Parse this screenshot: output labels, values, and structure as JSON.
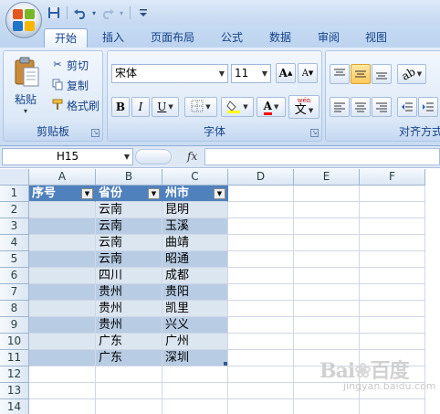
{
  "qat": {
    "items": [
      {
        "icon": "save-icon",
        "glyph": "💾"
      },
      {
        "icon": "undo-icon",
        "glyph": "↶"
      },
      {
        "icon": "redo-icon",
        "glyph": "↷"
      },
      {
        "icon": "customize-qat-icon",
        "glyph": "▾"
      }
    ]
  },
  "tabs": [
    {
      "label": "开始",
      "active": true
    },
    {
      "label": "插入"
    },
    {
      "label": "页面布局"
    },
    {
      "label": "公式"
    },
    {
      "label": "数据"
    },
    {
      "label": "审阅"
    },
    {
      "label": "视图"
    }
  ],
  "clipboard": {
    "paste": "粘贴",
    "cut": "剪切",
    "copy": "复制",
    "format_painter": "格式刷",
    "group_label": "剪贴板"
  },
  "font": {
    "name": "宋体",
    "size": "11",
    "grow": "A",
    "shrink": "A",
    "bold": "B",
    "italic": "I",
    "underline": "U",
    "font_color": "A",
    "phonetic": "文",
    "phonetic_top": "wén",
    "group_label": "字体"
  },
  "alignment": {
    "group_label": "对齐方式"
  },
  "formula_bar": {
    "name_box": "H15",
    "fx": "fx",
    "formula": ""
  },
  "sheet": {
    "columns": [
      "A",
      "B",
      "C",
      "D",
      "E",
      "F"
    ],
    "rows": [
      "1",
      "2",
      "3",
      "4",
      "5",
      "6",
      "7",
      "8",
      "9",
      "10",
      "11",
      "12",
      "13",
      "14"
    ],
    "header": [
      "序号",
      "省份",
      "州市"
    ],
    "data": [
      [
        "",
        "云南",
        "昆明"
      ],
      [
        "",
        "云南",
        "玉溪"
      ],
      [
        "",
        "云南",
        "曲靖"
      ],
      [
        "",
        "云南",
        "昭通"
      ],
      [
        "",
        "四川",
        "成都"
      ],
      [
        "",
        "贵州",
        "贵阳"
      ],
      [
        "",
        "贵州",
        "凯里"
      ],
      [
        "",
        "贵州",
        "兴义"
      ],
      [
        "",
        "广东",
        "广州"
      ],
      [
        "",
        "广东",
        "深圳"
      ]
    ],
    "table_header_color": "#4f81bd",
    "band_light": "#dce6f1",
    "band_dark": "#b8cce4"
  },
  "watermark": {
    "main": "Bai 百度",
    "sub": "jingyan.baidu.com"
  }
}
